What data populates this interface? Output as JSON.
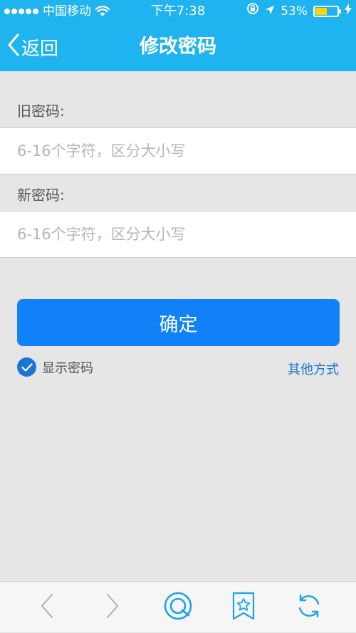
{
  "status_bar": {
    "carrier": "中国移动",
    "time": "下午7:38",
    "battery_text": "53%",
    "battery_level": 0.53
  },
  "nav": {
    "back_label": "返回",
    "title": "修改密码"
  },
  "form": {
    "old_password": {
      "label": "旧密码:",
      "placeholder": "6-16个字符，区分大小写",
      "value": ""
    },
    "new_password": {
      "label": "新密码:",
      "placeholder": "6-16个字符，区分大小写",
      "value": ""
    },
    "confirm_label": "确定",
    "show_password": {
      "label": "显示密码",
      "checked": true
    },
    "other_methods_label": "其他方式"
  },
  "toolbar": {
    "items": [
      "chevron-left-icon",
      "chevron-right-icon",
      "qq-browser-icon",
      "bookmark-star-icon",
      "refresh-icon"
    ]
  },
  "colors": {
    "header": "#1fb3ef",
    "primary_button": "#1181f7",
    "link": "#1976d2",
    "background": "#e6e6e6",
    "battery": "#ffd400"
  }
}
